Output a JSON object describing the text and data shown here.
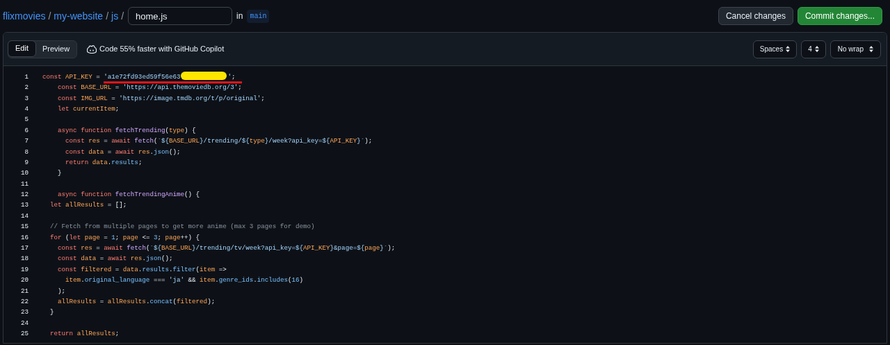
{
  "breadcrumb": {
    "links": [
      "flixmovies",
      "my-website",
      "js"
    ],
    "separator": "/",
    "filename": "home.js",
    "in_label": "in",
    "branch": "main"
  },
  "actions": [
    {
      "label": "Cancel changes",
      "kind": "secondary"
    },
    {
      "label": "Commit changes...",
      "kind": "primary"
    }
  ],
  "tabs": [
    {
      "label": "Edit",
      "selected": true
    },
    {
      "label": "Preview",
      "selected": false
    }
  ],
  "copilot_note": "Code 55% faster with GitHub Copilot",
  "selects": [
    "Spaces",
    "4",
    "No wrap"
  ],
  "lines": [
    {
      "number": "1",
      "tokens": [
        {
          "kind": "kw",
          "text": "const "
        },
        {
          "kind": "var",
          "text": "API_KEY"
        },
        {
          "kind": "plain",
          "text": " = "
        },
        {
          "kind": "str",
          "text": "'a1e72fd93ed59f56e63"
        },
        {
          "kind": "redaction"
        },
        {
          "kind": "str",
          "text": "'"
        },
        {
          "kind": "plain",
          "text": ";"
        }
      ]
    },
    {
      "number": "2",
      "tokens": [
        {
          "kind": "kw",
          "text": "    const "
        },
        {
          "kind": "var",
          "text": "BASE_URL"
        },
        {
          "kind": "plain",
          "text": " = "
        },
        {
          "kind": "str",
          "text": "'https://api.themoviedb.org/3'"
        },
        {
          "kind": "plain",
          "text": ";"
        }
      ]
    },
    {
      "number": "3",
      "tokens": [
        {
          "kind": "kw",
          "text": "    const "
        },
        {
          "kind": "var",
          "text": "IMG_URL"
        },
        {
          "kind": "plain",
          "text": " = "
        },
        {
          "kind": "str",
          "text": "'https://image.tmdb.org/t/p/original'"
        },
        {
          "kind": "plain",
          "text": ";"
        }
      ]
    },
    {
      "number": "4",
      "tokens": [
        {
          "kind": "kw",
          "text": "    let "
        },
        {
          "kind": "var",
          "text": "currentItem"
        },
        {
          "kind": "plain",
          "text": ";"
        }
      ]
    },
    {
      "number": "5"
    },
    {
      "number": "6",
      "tokens": [
        {
          "kind": "kw",
          "text": "    async function "
        },
        {
          "kind": "fn",
          "text": "fetchTrending"
        },
        {
          "kind": "plain",
          "text": "("
        },
        {
          "kind": "var",
          "text": "type"
        },
        {
          "kind": "plain",
          "text": ") {"
        }
      ]
    },
    {
      "number": "7",
      "tokens": [
        {
          "kind": "kw",
          "text": "      const "
        },
        {
          "kind": "var",
          "text": "res"
        },
        {
          "kind": "plain",
          "text": " = "
        },
        {
          "kind": "kw",
          "text": "await "
        },
        {
          "kind": "fn",
          "text": "fetch"
        },
        {
          "kind": "plain",
          "text": "("
        },
        {
          "kind": "str",
          "text": "`${"
        },
        {
          "kind": "var",
          "text": "BASE_URL"
        },
        {
          "kind": "str",
          "text": "}/trending/${"
        },
        {
          "kind": "var",
          "text": "type"
        },
        {
          "kind": "str",
          "text": "}/week?api_key=${"
        },
        {
          "kind": "var",
          "text": "API_KEY"
        },
        {
          "kind": "str",
          "text": "}`"
        },
        {
          "kind": "plain",
          "text": ");"
        }
      ]
    },
    {
      "number": "8",
      "tokens": [
        {
          "kind": "kw",
          "text": "      const "
        },
        {
          "kind": "var",
          "text": "data"
        },
        {
          "kind": "plain",
          "text": " = "
        },
        {
          "kind": "kw",
          "text": "await "
        },
        {
          "kind": "var",
          "text": "res"
        },
        {
          "kind": "plain",
          "text": "."
        },
        {
          "kind": "prop",
          "text": "json"
        },
        {
          "kind": "plain",
          "text": "();"
        }
      ]
    },
    {
      "number": "9",
      "tokens": [
        {
          "kind": "kw",
          "text": "      return "
        },
        {
          "kind": "var",
          "text": "data"
        },
        {
          "kind": "plain",
          "text": "."
        },
        {
          "kind": "prop",
          "text": "results"
        },
        {
          "kind": "plain",
          "text": ";"
        }
      ]
    },
    {
      "number": "10",
      "tokens": [
        {
          "kind": "plain",
          "text": "    }"
        }
      ]
    },
    {
      "number": "11"
    },
    {
      "number": "12",
      "tokens": [
        {
          "kind": "kw",
          "text": "    async function "
        },
        {
          "kind": "fn",
          "text": "fetchTrendingAnime"
        },
        {
          "kind": "plain",
          "text": "() {"
        }
      ]
    },
    {
      "number": "13",
      "tokens": [
        {
          "kind": "kw",
          "text": "  let "
        },
        {
          "kind": "var",
          "text": "allResults"
        },
        {
          "kind": "plain",
          "text": " = [];"
        }
      ]
    },
    {
      "number": "14"
    },
    {
      "number": "15",
      "tokens": [
        {
          "kind": "comment",
          "text": "  // Fetch from multiple pages to get more anime (max 3 pages for demo)"
        }
      ]
    },
    {
      "number": "16",
      "tokens": [
        {
          "kind": "kw",
          "text": "  for "
        },
        {
          "kind": "plain",
          "text": "("
        },
        {
          "kind": "kw",
          "text": "let "
        },
        {
          "kind": "var",
          "text": "page"
        },
        {
          "kind": "plain",
          "text": " = "
        },
        {
          "kind": "num",
          "text": "1"
        },
        {
          "kind": "plain",
          "text": "; "
        },
        {
          "kind": "var",
          "text": "page"
        },
        {
          "kind": "plain",
          "text": " <= "
        },
        {
          "kind": "num",
          "text": "3"
        },
        {
          "kind": "plain",
          "text": "; "
        },
        {
          "kind": "var",
          "text": "page"
        },
        {
          "kind": "plain",
          "text": "++) {"
        }
      ]
    },
    {
      "number": "17",
      "tokens": [
        {
          "kind": "kw",
          "text": "    const "
        },
        {
          "kind": "var",
          "text": "res"
        },
        {
          "kind": "plain",
          "text": " = "
        },
        {
          "kind": "kw",
          "text": "await "
        },
        {
          "kind": "fn",
          "text": "fetch"
        },
        {
          "kind": "plain",
          "text": "("
        },
        {
          "kind": "str",
          "text": "`${"
        },
        {
          "kind": "var",
          "text": "BASE_URL"
        },
        {
          "kind": "str",
          "text": "}/trending/tv/week?api_key=${"
        },
        {
          "kind": "var",
          "text": "API_KEY"
        },
        {
          "kind": "str",
          "text": "}&page=${"
        },
        {
          "kind": "var",
          "text": "page"
        },
        {
          "kind": "str",
          "text": "}`"
        },
        {
          "kind": "plain",
          "text": ");"
        }
      ]
    },
    {
      "number": "18",
      "tokens": [
        {
          "kind": "kw",
          "text": "    const "
        },
        {
          "kind": "var",
          "text": "data"
        },
        {
          "kind": "plain",
          "text": " = "
        },
        {
          "kind": "kw",
          "text": "await "
        },
        {
          "kind": "var",
          "text": "res"
        },
        {
          "kind": "plain",
          "text": "."
        },
        {
          "kind": "prop",
          "text": "json"
        },
        {
          "kind": "plain",
          "text": "();"
        }
      ]
    },
    {
      "number": "19",
      "tokens": [
        {
          "kind": "kw",
          "text": "    const "
        },
        {
          "kind": "var",
          "text": "filtered"
        },
        {
          "kind": "plain",
          "text": " = "
        },
        {
          "kind": "var",
          "text": "data"
        },
        {
          "kind": "plain",
          "text": "."
        },
        {
          "kind": "prop",
          "text": "results"
        },
        {
          "kind": "plain",
          "text": "."
        },
        {
          "kind": "prop",
          "text": "filter"
        },
        {
          "kind": "plain",
          "text": "("
        },
        {
          "kind": "var",
          "text": "item"
        },
        {
          "kind": "plain",
          "text": " =>"
        }
      ]
    },
    {
      "number": "20",
      "tokens": [
        {
          "kind": "var",
          "text": "      item"
        },
        {
          "kind": "plain",
          "text": "."
        },
        {
          "kind": "prop",
          "text": "original_language"
        },
        {
          "kind": "plain",
          "text": " === "
        },
        {
          "kind": "str",
          "text": "'ja'"
        },
        {
          "kind": "plain",
          "text": " && "
        },
        {
          "kind": "var",
          "text": "item"
        },
        {
          "kind": "plain",
          "text": "."
        },
        {
          "kind": "prop",
          "text": "genre_ids"
        },
        {
          "kind": "plain",
          "text": "."
        },
        {
          "kind": "prop",
          "text": "includes"
        },
        {
          "kind": "plain",
          "text": "("
        },
        {
          "kind": "num",
          "text": "16"
        },
        {
          "kind": "plain",
          "text": ")"
        }
      ]
    },
    {
      "number": "21",
      "tokens": [
        {
          "kind": "plain",
          "text": "    );"
        }
      ]
    },
    {
      "number": "22",
      "tokens": [
        {
          "kind": "var",
          "text": "    allResults"
        },
        {
          "kind": "plain",
          "text": " = "
        },
        {
          "kind": "var",
          "text": "allResults"
        },
        {
          "kind": "plain",
          "text": "."
        },
        {
          "kind": "prop",
          "text": "concat"
        },
        {
          "kind": "plain",
          "text": "("
        },
        {
          "kind": "var",
          "text": "filtered"
        },
        {
          "kind": "plain",
          "text": ");"
        }
      ]
    },
    {
      "number": "23",
      "tokens": [
        {
          "kind": "plain",
          "text": "  }"
        }
      ]
    },
    {
      "number": "24"
    },
    {
      "number": "25",
      "tokens": [
        {
          "kind": "kw",
          "text": "  return "
        },
        {
          "kind": "var",
          "text": "allResults"
        },
        {
          "kind": "plain",
          "text": ";"
        }
      ]
    }
  ]
}
